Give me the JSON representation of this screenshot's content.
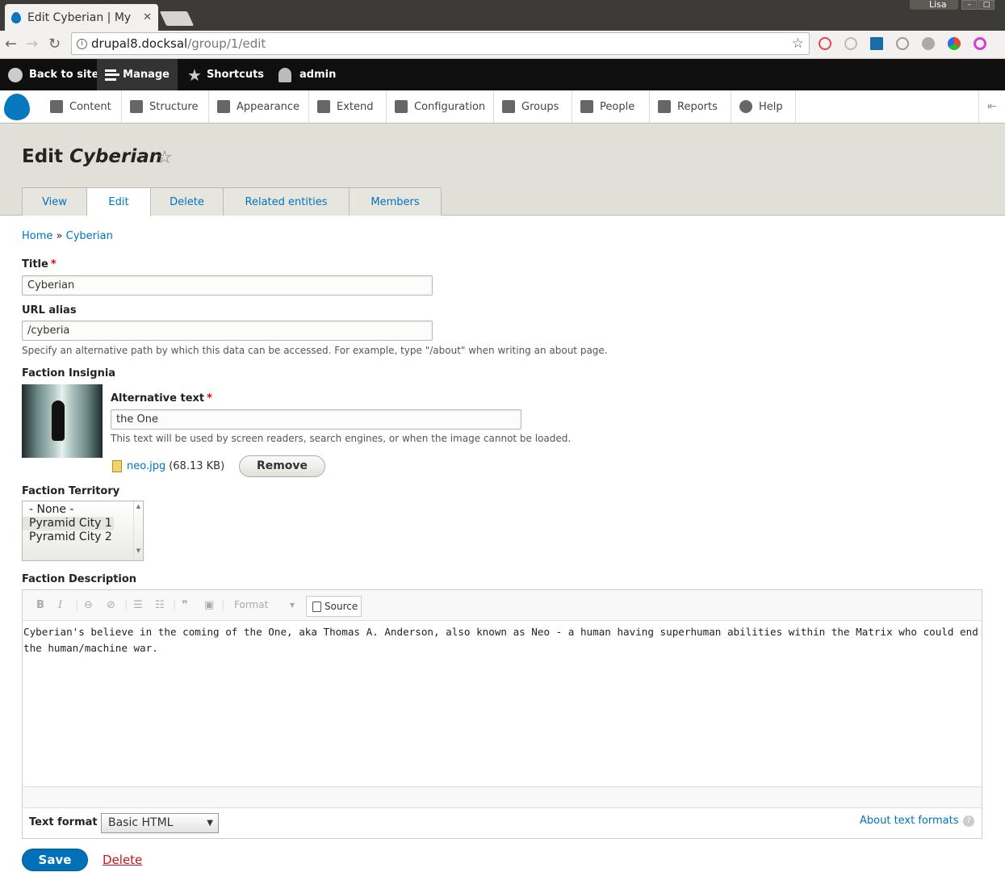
{
  "browser": {
    "tab_title": "Edit Cyberian | My D",
    "tab_close": "✕",
    "user_name": "Lisa",
    "url_host": "drupal8.docksal",
    "url_path": "/group/1/edit"
  },
  "admin_toolbar": {
    "back_to_site": "Back to site",
    "manage": "Manage",
    "shortcuts": "Shortcuts",
    "user": "admin"
  },
  "tray": {
    "items": [
      "Content",
      "Structure",
      "Appearance",
      "Extend",
      "Configuration",
      "Groups",
      "People",
      "Reports",
      "Help"
    ]
  },
  "header": {
    "title_prefix": "Edit",
    "title_name": "Cyberian",
    "tabs": [
      "View",
      "Edit",
      "Delete",
      "Related entities",
      "Members"
    ]
  },
  "breadcrumb": {
    "home": "Home",
    "sep": "»",
    "current": "Cyberian"
  },
  "form": {
    "title_label": "Title",
    "required_mark": "*",
    "title_value": "Cyberian",
    "url_alias_label": "URL alias",
    "url_alias_value": "/cyberia",
    "url_alias_desc": "Specify an alternative path by which this data can be accessed. For example, type \"/about\" when writing an about page.",
    "insignia_label": "Faction Insignia",
    "alt_text_label": "Alternative text",
    "alt_text_value": "the One",
    "alt_text_desc": "This text will be used by screen readers, search engines, or when the image cannot be loaded.",
    "file_name": "neo.jpg",
    "file_size": "(68.13 KB)",
    "remove_button": "Remove",
    "territory_label": "Faction Territory",
    "territory_options": [
      "- None -",
      "Pyramid City 1",
      "Pyramid City 2"
    ],
    "description_label": "Faction Description",
    "editor_format_placeholder": "Format",
    "editor_source_button": "Source",
    "editor_text": "Cyberian's believe in the coming of the One, aka Thomas A. Anderson, also known as Neo - a human having superhuman abilities within the Matrix who could end the human/machine war.",
    "text_format_label": "Text format",
    "text_format_value": "Basic HTML",
    "about_text_formats": "About text formats",
    "save_button": "Save",
    "delete_link": "Delete"
  },
  "colors": {
    "link": "#0074bd",
    "primary_button": "#0071b8",
    "danger": "#c4161c",
    "toolbar_bg": "#0f0f0f",
    "header_bg": "#e0e0d8"
  }
}
